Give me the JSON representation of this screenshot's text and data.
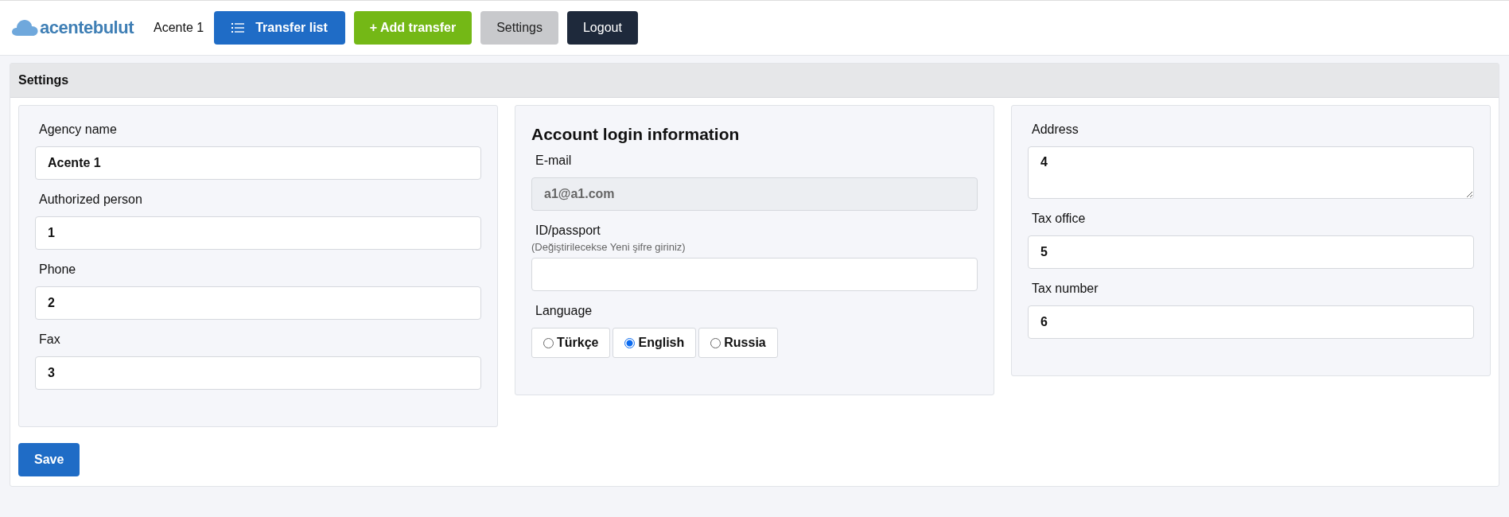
{
  "header": {
    "logo": "acentebulut",
    "user": "Acente 1",
    "buttons": [
      {
        "label": "Transfer list",
        "kind": "primary"
      },
      {
        "label": "+ Add transfer",
        "kind": "success"
      },
      {
        "label": "Settings",
        "kind": "secondary"
      },
      {
        "label": "Logout",
        "kind": "dark"
      }
    ]
  },
  "panel": {
    "title": "Settings",
    "columns": [
      {
        "fields": [
          {
            "label": "Agency name",
            "value": "Acente 1",
            "kind": "input",
            "disabled": false
          },
          {
            "label": "Authorized person",
            "value": "1",
            "kind": "input",
            "disabled": false
          },
          {
            "label": "Phone",
            "value": "2",
            "kind": "input",
            "disabled": false
          },
          {
            "label": "Fax",
            "value": "3",
            "kind": "input",
            "disabled": false
          }
        ]
      },
      {
        "heading": "Account login information",
        "fields": [
          {
            "label": "E-mail",
            "value": "a1@a1.com",
            "kind": "input",
            "disabled": true
          },
          {
            "label": "ID/passport",
            "hint": "(Değiştirilecekse Yeni şifre giriniz)",
            "kind": "input",
            "disabled": false
          }
        ],
        "language": {
          "label": "Language",
          "options": [
            {
              "label": "Türkçe",
              "selected": false
            },
            {
              "label": "English",
              "selected": true
            },
            {
              "label": "Russia",
              "selected": false
            }
          ]
        }
      },
      {
        "fields": [
          {
            "label": "Address",
            "value": "4",
            "kind": "textarea",
            "disabled": false
          },
          {
            "label": "Tax office",
            "value": "5",
            "kind": "input",
            "disabled": false
          },
          {
            "label": "Tax number",
            "value": "6",
            "kind": "input",
            "disabled": false
          }
        ]
      }
    ],
    "save": "Save"
  }
}
